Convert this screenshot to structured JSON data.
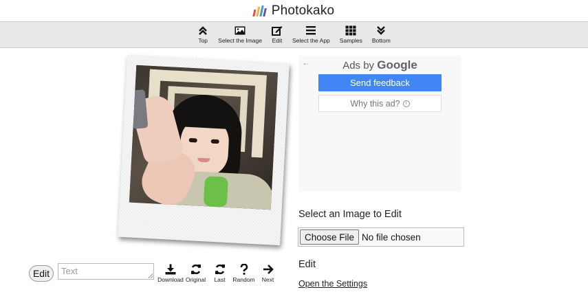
{
  "header": {
    "app_title": "Photokako",
    "logo_colors": [
      "#e84d3d",
      "#f2b233",
      "#3a9bd9",
      "#6a4fa3"
    ]
  },
  "navbar": {
    "items": [
      {
        "label": "Top",
        "icon": "chevrons-up-icon"
      },
      {
        "label": "Select the Image",
        "icon": "image-icon"
      },
      {
        "label": "Edit",
        "icon": "edit-icon"
      },
      {
        "label": "Select the App",
        "icon": "list-icon"
      },
      {
        "label": "Samples",
        "icon": "grid-icon"
      },
      {
        "label": "Bottom",
        "icon": "chevrons-down-icon"
      }
    ]
  },
  "ad": {
    "back_symbol": "←",
    "title_prefix": "Ads by",
    "title_brand": "Google",
    "send_feedback": "Send feedback",
    "why_this_ad": "Why this ad?",
    "info_symbol": "i",
    "accent_color": "#4285f4"
  },
  "file_select": {
    "heading": "Select an Image to Edit",
    "button_label": "Choose File",
    "status": "No file chosen"
  },
  "edit_section": {
    "heading": "Edit",
    "settings_link": "Open the Settings"
  },
  "bottom_controls": {
    "edit_button": "Edit",
    "text_placeholder": "Text",
    "tools": [
      {
        "label": "Download",
        "icon": "download-icon"
      },
      {
        "label": "Original",
        "icon": "refresh-icon"
      },
      {
        "label": "Last",
        "icon": "refresh-icon"
      },
      {
        "label": "Random",
        "icon": "question-icon"
      },
      {
        "label": "Next",
        "icon": "arrow-right-icon"
      }
    ]
  }
}
